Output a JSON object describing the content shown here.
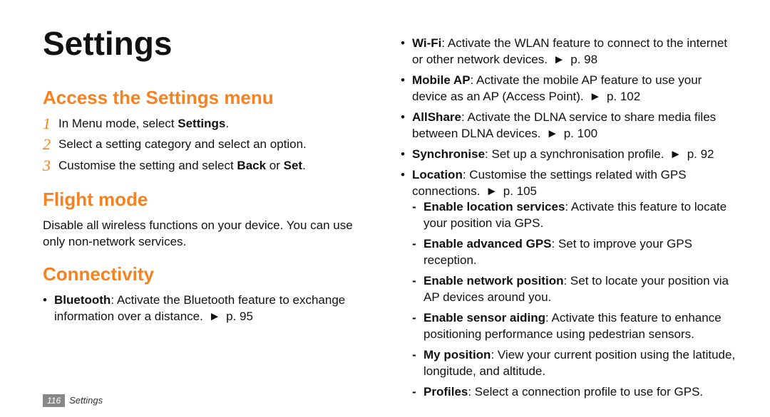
{
  "title": "Settings",
  "left": {
    "access": {
      "heading": "Access the Settings menu",
      "steps": [
        {
          "num": "1",
          "pre": "In Menu mode, select ",
          "bold": "Settings",
          "post": "."
        },
        {
          "num": "2",
          "pre": "Select a setting category and select an option.",
          "bold": "",
          "post": ""
        },
        {
          "num": "3",
          "pre": "Customise the setting and select ",
          "bold": "Back",
          "mid": " or ",
          "bold2": "Set",
          "post": "."
        }
      ]
    },
    "flight": {
      "heading": "Flight mode",
      "body": "Disable all wireless functions on your device. You can use only non-network services."
    },
    "connectivity": {
      "heading": "Connectivity",
      "bluetooth": {
        "term": "Bluetooth",
        "desc": ": Activate the Bluetooth feature to exchange information over a distance. ",
        "ref": "p. 95"
      }
    }
  },
  "right": {
    "items": [
      {
        "term": "Wi-Fi",
        "desc": ": Activate the WLAN feature to connect to the internet or other network devices. ",
        "ref": "p. 98"
      },
      {
        "term": "Mobile AP",
        "desc": ": Activate the mobile AP feature to use your device as an AP (Access Point). ",
        "ref": "p. 102"
      },
      {
        "term": "AllShare",
        "desc": ": Activate the DLNA service to share media files between DLNA devices. ",
        "ref": "p. 100"
      },
      {
        "term": "Synchronise",
        "desc": ": Set up a synchronisation profile. ",
        "ref": "p. 92"
      },
      {
        "term": "Location",
        "desc": ": Customise the settings related with GPS connections. ",
        "ref": "p. 105"
      }
    ],
    "location_sub": [
      {
        "term": "Enable location services",
        "desc": ": Activate this feature to locate your position via GPS."
      },
      {
        "term": "Enable advanced GPS",
        "desc": ": Set to improve your GPS reception."
      },
      {
        "term": "Enable network position",
        "desc": ": Set to locate your position via AP devices around you."
      },
      {
        "term": "Enable sensor aiding",
        "desc": ": Activate this feature to enhance positioning performance using pedestrian sensors."
      },
      {
        "term": "My position",
        "desc": ": View your current position using the latitude, longitude, and altitude."
      },
      {
        "term": "Profiles",
        "desc": ": Select a connection profile to use for GPS."
      }
    ]
  },
  "footer": {
    "page": "116",
    "section": "Settings"
  },
  "glyphs": {
    "arrow": "►"
  }
}
